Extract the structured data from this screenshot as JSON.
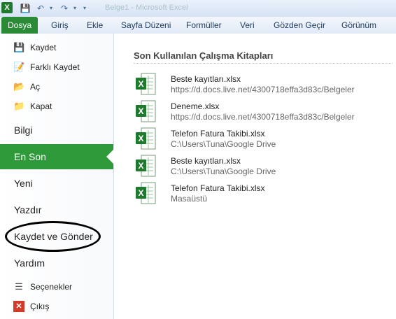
{
  "titlebar": {
    "app_icon_letter": "X",
    "title": "Belge1 - Microsoft Excel"
  },
  "ribbon": {
    "file_tab": "Dosya",
    "tabs": [
      "Giriş",
      "Ekle",
      "Sayfa Düzeni",
      "Formüller",
      "Veri",
      "Gözden Geçir",
      "Görünüm"
    ]
  },
  "backstage": {
    "items": {
      "save": "Kaydet",
      "save_as": "Farklı Kaydet",
      "open": "Aç",
      "close": "Kapat",
      "info": "Bilgi",
      "recent": "En Son",
      "new": "Yeni",
      "print": "Yazdır",
      "save_send": "Kaydet ve Gönder",
      "help": "Yardım",
      "options": "Seçenekler",
      "exit": "Çıkış"
    },
    "selected": "recent"
  },
  "recent": {
    "heading": "Son Kullanılan Çalışma Kitapları",
    "files": [
      {
        "name": "Beste kayıtları.xlsx",
        "path": "https://d.docs.live.net/4300718effa3d83c/Belgeler"
      },
      {
        "name": "Deneme.xlsx",
        "path": "https://d.docs.live.net/4300718effa3d83c/Belgeler"
      },
      {
        "name": "Telefon Fatura Takibi.xlsx",
        "path": "C:\\Users\\Tuna\\Google Drive"
      },
      {
        "name": "Beste kayıtları.xlsx",
        "path": "C:\\Users\\Tuna\\Google Drive"
      },
      {
        "name": "Telefon Fatura Takibi.xlsx",
        "path": "Masaüstü"
      }
    ]
  },
  "colors": {
    "accent_green": "#2f9a3a",
    "file_tab_green": "#2a8a36"
  }
}
